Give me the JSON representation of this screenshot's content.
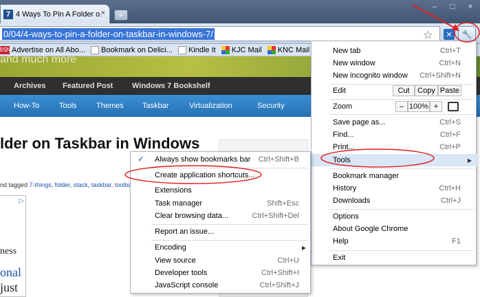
{
  "tab": {
    "favicon_text": "7",
    "title": "4 Ways To Pin A Folder o...",
    "close_glyph": "×",
    "new_tab_glyph": "+"
  },
  "window_controls": {
    "minimize": "–",
    "maximize": "□",
    "close": "×"
  },
  "toolbar": {
    "url": "0/04/4-ways-to-pin-a-folder-on-taskbar-in-windows-7/",
    "star_glyph": "☆",
    "extension_glyph": "✕",
    "wrench_glyph": "🔧"
  },
  "bookmarks": [
    {
      "icon": "BSN",
      "label": "Advertise on All Abo..."
    },
    {
      "icon": "",
      "label": "Bookmark on Delici..."
    },
    {
      "icon": "",
      "label": "Kindle It"
    },
    {
      "icon": "",
      "label": "KJC Mail"
    },
    {
      "icon": "",
      "label": "KNC Mail"
    }
  ],
  "page": {
    "header_text": "and much more",
    "nav_top": [
      "Archives",
      "Featured Post",
      "Windows 7 Bookshelf"
    ],
    "nav_main": [
      "How-To",
      "Tools",
      "Themes",
      "Taskbar",
      "Virtualization",
      "Security"
    ],
    "article_title": "lder on Taskbar in Windows",
    "tagline_prefix": "nd tagged",
    "tags": [
      "7-things",
      "folder",
      "stack",
      "taskbar",
      "toolba"
    ],
    "ad_icon": "▷",
    "ad_lines": [
      "ness",
      "onal",
      "just"
    ]
  },
  "menu": {
    "new_tab": {
      "label": "New tab",
      "shortcut": "Ctrl+T"
    },
    "new_window": {
      "label": "New window",
      "shortcut": "Ctrl+N"
    },
    "incognito": {
      "label": "New incognito window",
      "shortcut": "Ctrl+Shift+N"
    },
    "edit": {
      "label": "Edit",
      "cut": "Cut",
      "copy": "Copy",
      "paste": "Paste"
    },
    "zoom": {
      "label": "Zoom",
      "minus": "–",
      "value": "100%",
      "plus": "+"
    },
    "save_page": {
      "label": "Save page as...",
      "shortcut": "Ctrl+S"
    },
    "find": {
      "label": "Find...",
      "shortcut": "Ctrl+F"
    },
    "print": {
      "label": "Print...",
      "shortcut": "Ctrl+P"
    },
    "tools": {
      "label": "Tools",
      "arrow": "▶"
    },
    "bookmark_manager": {
      "label": "Bookmark manager"
    },
    "history": {
      "label": "History",
      "shortcut": "Ctrl+H"
    },
    "downloads": {
      "label": "Downloads",
      "shortcut": "Ctrl+J"
    },
    "options": {
      "label": "Options"
    },
    "about": {
      "label": "About Google Chrome"
    },
    "help": {
      "label": "Help",
      "shortcut": "F1"
    },
    "exit": {
      "label": "Exit"
    }
  },
  "submenu": {
    "check_glyph": "✓",
    "always_show": {
      "label": "Always show bookmarks bar",
      "shortcut": "Ctrl+Shift+B"
    },
    "create_shortcuts": {
      "label": "Create application shortcuts..."
    },
    "extensions": {
      "label": "Extensions"
    },
    "task_manager": {
      "label": "Task manager",
      "shortcut": "Shift+Esc"
    },
    "clear_data": {
      "label": "Clear browsing data...",
      "shortcut": "Ctrl+Shift+Del"
    },
    "report_issue": {
      "label": "Report an issue..."
    },
    "encoding": {
      "label": "Encoding",
      "arrow": "▶"
    },
    "view_source": {
      "label": "View source",
      "shortcut": "Ctrl+U"
    },
    "dev_tools": {
      "label": "Developer tools",
      "shortcut": "Ctrl+Shift+I"
    },
    "js_console": {
      "label": "JavaScript console",
      "shortcut": "Ctrl+Shift+J"
    }
  },
  "colors": {
    "highlight": "#d8e6f6",
    "annotation_red": "#e02020",
    "url_selection": "#3875d7"
  }
}
